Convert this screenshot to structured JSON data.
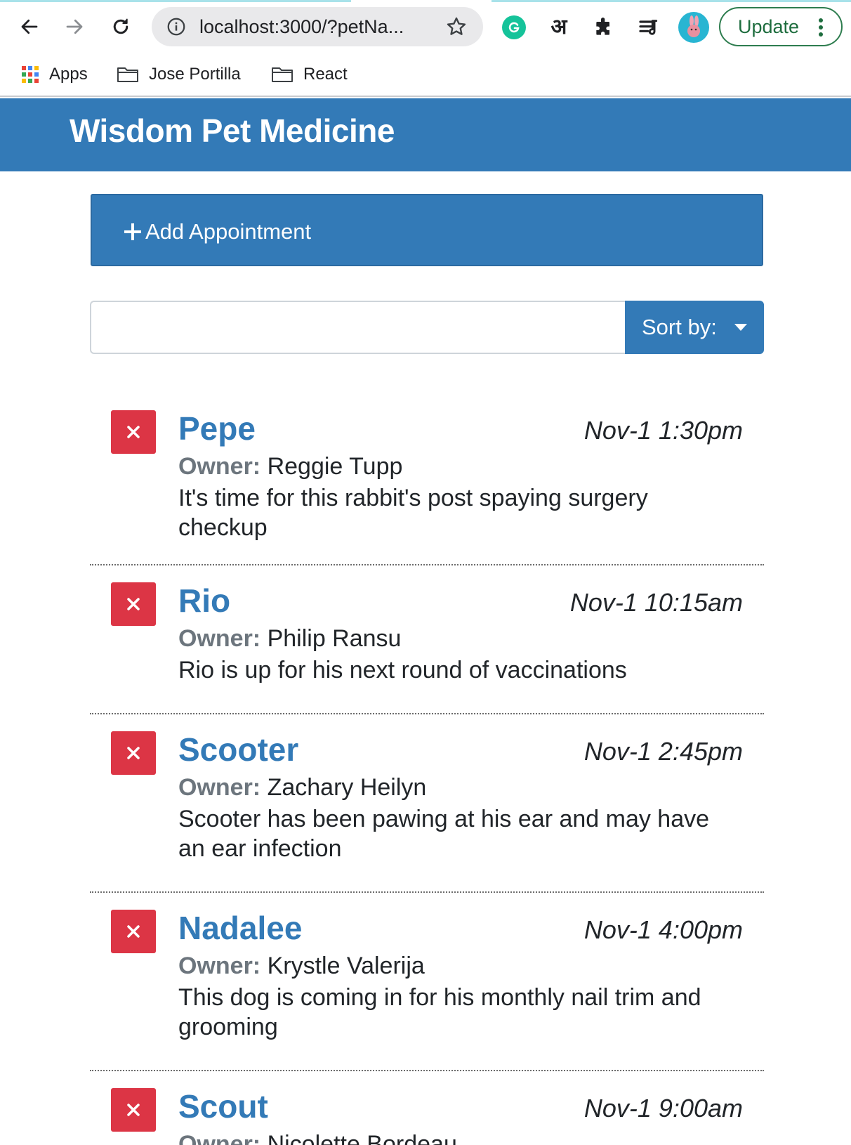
{
  "browser": {
    "url": "localhost:3000/?petNa...",
    "update_label": "Update",
    "ext_hindi_glyph": "अ",
    "bookmarks": [
      {
        "label": "Apps",
        "icon": "apps-grid-icon"
      },
      {
        "label": "Jose Portilla",
        "icon": "folder-icon"
      },
      {
        "label": "React",
        "icon": "folder-icon"
      }
    ]
  },
  "app": {
    "title": "Wisdom Pet Medicine",
    "add_appointment_label": "Add Appointment",
    "search": {
      "value": "",
      "placeholder": ""
    },
    "sort_label": "Sort by:",
    "owner_key": "Owner:",
    "colors": {
      "primary": "#337ab7",
      "danger": "#dc3545",
      "muted": "#6c757d"
    }
  },
  "appointments": [
    {
      "pet": "Pepe",
      "date": "Nov-1 1:30pm",
      "owner": "Reggie Tupp",
      "notes": "It's time for this rabbit's post spaying surgery checkup"
    },
    {
      "pet": "Rio",
      "date": "Nov-1 10:15am",
      "owner": "Philip Ransu",
      "notes": "Rio is up for his next round of vaccinations"
    },
    {
      "pet": "Scooter",
      "date": "Nov-1 2:45pm",
      "owner": "Zachary Heilyn",
      "notes": "Scooter has been pawing at his ear and may have an ear infection"
    },
    {
      "pet": "Nadalee",
      "date": "Nov-1 4:00pm",
      "owner": "Krystle Valerija",
      "notes": "This dog is coming in for his monthly nail trim and grooming"
    },
    {
      "pet": "Scout",
      "date": "Nov-1 9:00am",
      "owner": "Nicolette Bordeau",
      "notes": ""
    }
  ]
}
